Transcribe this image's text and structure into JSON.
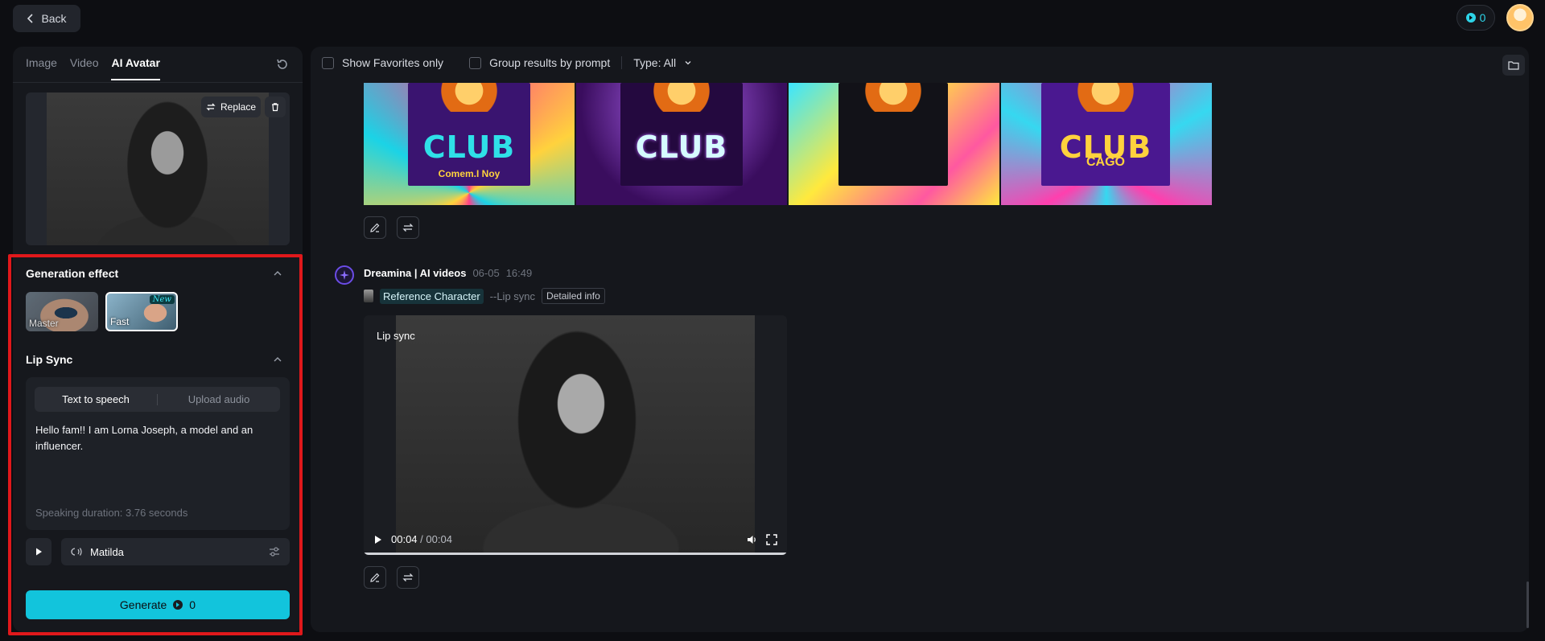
{
  "topbar": {
    "back_label": "Back",
    "credits": "0"
  },
  "left": {
    "tabs": [
      {
        "label": "Image",
        "active": false
      },
      {
        "label": "Video",
        "active": false
      },
      {
        "label": "AI Avatar",
        "active": true
      }
    ],
    "replace_label": "Replace",
    "generation_effect": {
      "title": "Generation effect",
      "options": [
        {
          "label": "Master",
          "selected": false
        },
        {
          "label": "Fast",
          "selected": true,
          "badge": "New"
        }
      ]
    },
    "lip_sync": {
      "title": "Lip Sync",
      "modes": [
        "Text to speech",
        "Upload audio"
      ],
      "active_mode": "Text to speech",
      "text": "Hello fam!! I am Lorna Joseph, a model and an influencer.",
      "duration": "Speaking duration: 3.76 seconds",
      "voice": "Matilda"
    },
    "generate": {
      "label": "Generate",
      "cost": "0"
    }
  },
  "main": {
    "filters": {
      "favorites_label": "Show Favorites only",
      "group_label": "Group results by prompt",
      "type_label": "Type: All"
    },
    "posters": [
      {
        "word": "CLUB",
        "sub": "Comem.I Noy"
      },
      {
        "word": "CLUB",
        "sub": ""
      },
      {
        "word": "",
        "sub": ""
      },
      {
        "word": "CLUB",
        "sub": "CAGO"
      }
    ],
    "generation": {
      "author": "Dreamina | AI videos",
      "date": "06-05",
      "time": "16:49",
      "ref_tag": "Reference Character",
      "prompt_suffix": "--Lip sync",
      "detail_label": "Detailed info",
      "video": {
        "label": "Lip sync",
        "current_time": "00:04",
        "duration": "00:04",
        "progress": 1.0
      }
    }
  },
  "colors": {
    "accent": "#12c4dc",
    "highlight": "#e0181b",
    "background": "#0d0e12"
  }
}
